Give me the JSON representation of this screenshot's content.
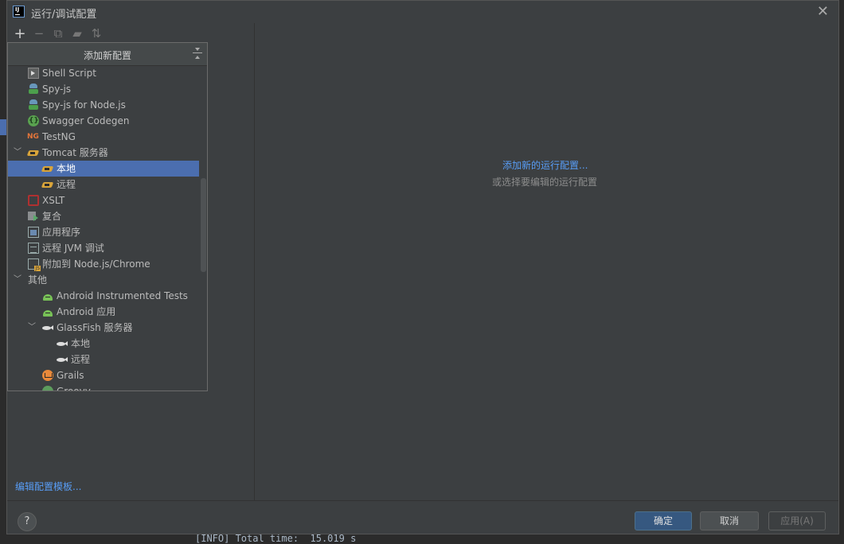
{
  "dialog": {
    "title": "运行/调试配置",
    "edit_templates": "编辑配置模板...",
    "add_new_link": "添加新的运行配置...",
    "hint": "或选择要编辑的运行配置"
  },
  "popup": {
    "title": "添加新配置",
    "items": [
      {
        "label": "Shell Script",
        "icon": "shell-script-icon"
      },
      {
        "label": "Spy-js",
        "icon": "spy-js-icon"
      },
      {
        "label": "Spy-js for Node.js",
        "icon": "spy-js-icon"
      },
      {
        "label": "Swagger Codegen",
        "icon": "swagger-icon"
      },
      {
        "label": "TestNG",
        "icon": "testng-icon"
      },
      {
        "label": "Tomcat 服务器",
        "icon": "tomcat-icon",
        "expanded": true
      },
      {
        "label": "本地",
        "icon": "tomcat-icon",
        "selected": true
      },
      {
        "label": "远程",
        "icon": "tomcat-icon"
      },
      {
        "label": "XSLT",
        "icon": "xslt-icon"
      },
      {
        "label": "复合",
        "icon": "compound-icon"
      },
      {
        "label": "应用程序",
        "icon": "application-icon"
      },
      {
        "label": "远程 JVM 调试",
        "icon": "remote-debug-icon"
      },
      {
        "label": "附加到 Node.js/Chrome",
        "icon": "attach-node-icon"
      },
      {
        "label": "其他",
        "expanded": true
      },
      {
        "label": "Android Instrumented Tests",
        "icon": "android-icon"
      },
      {
        "label": "Android 应用",
        "icon": "android-icon"
      },
      {
        "label": "GlassFish 服务器",
        "icon": "glassfish-icon",
        "expanded": true
      },
      {
        "label": "本地",
        "icon": "glassfish-icon"
      },
      {
        "label": "远程",
        "icon": "glassfish-icon"
      },
      {
        "label": "Grails",
        "icon": "grails-icon"
      },
      {
        "label": "Groovy",
        "icon": "groovy-icon"
      }
    ]
  },
  "buttons": {
    "ok": "确定",
    "cancel": "取消",
    "apply": "应用(A)",
    "help": "?"
  },
  "background": {
    "console_line": "[INFO] Total time:  15.019 s"
  }
}
